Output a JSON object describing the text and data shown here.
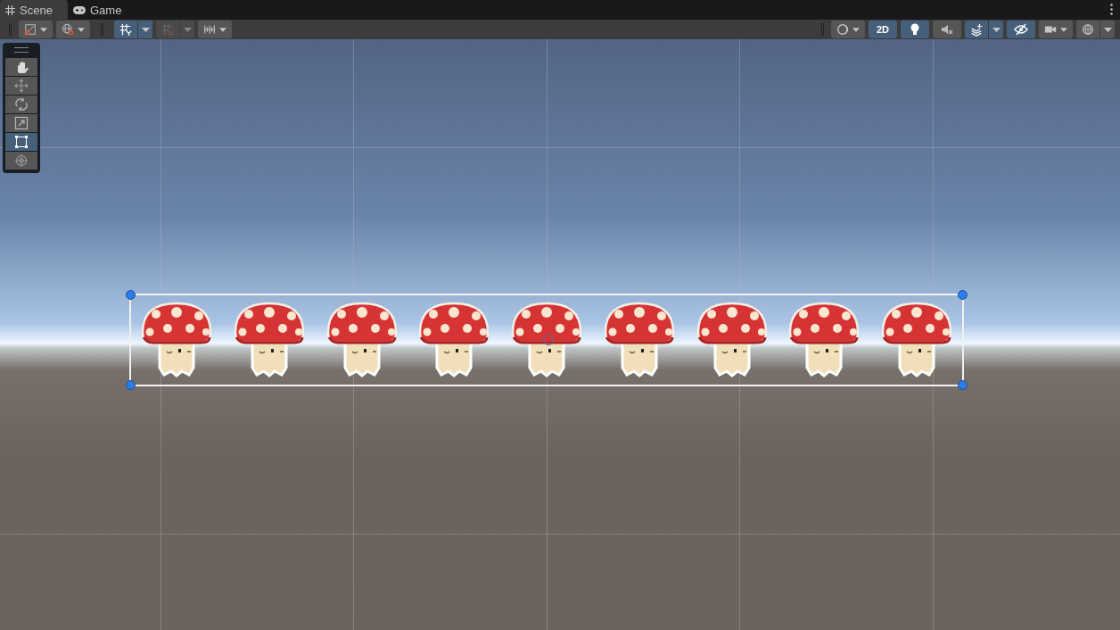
{
  "tabs": [
    {
      "label": "Scene",
      "selected": true
    },
    {
      "label": "Game",
      "selected": false
    }
  ],
  "toolbar_left": [
    {
      "kind": "dropdown",
      "on": false,
      "disabled": false
    },
    {
      "kind": "dropdown",
      "on": false,
      "disabled": false
    },
    {
      "kind": "split",
      "on": true,
      "disabled": false
    },
    {
      "kind": "split",
      "on": false,
      "disabled": true
    },
    {
      "kind": "dropdown",
      "on": false,
      "disabled": false
    }
  ],
  "toolbar_right": [
    {
      "kind": "dropdown",
      "on": false
    },
    {
      "kind": "toggle",
      "on": true,
      "label": "2D"
    },
    {
      "kind": "toggle",
      "on": true
    },
    {
      "kind": "toggle",
      "on": false
    },
    {
      "kind": "split",
      "on": true
    },
    {
      "kind": "toggle",
      "on": true
    },
    {
      "kind": "dropdown",
      "on": false
    },
    {
      "kind": "split",
      "on": false
    }
  ],
  "tools": [
    {
      "selected": false
    },
    {
      "selected": false
    },
    {
      "selected": false
    },
    {
      "selected": false
    },
    {
      "selected": true
    },
    {
      "selected": false
    }
  ],
  "selection": {
    "selected": true
  },
  "sprites": [
    {
      "kind": "mushroom"
    },
    {
      "kind": "mushroom"
    },
    {
      "kind": "mushroom"
    },
    {
      "kind": "mushroom"
    },
    {
      "kind": "mushroom"
    },
    {
      "kind": "mushroom"
    },
    {
      "kind": "mushroom"
    },
    {
      "kind": "mushroom"
    },
    {
      "kind": "mushroom"
    }
  ]
}
